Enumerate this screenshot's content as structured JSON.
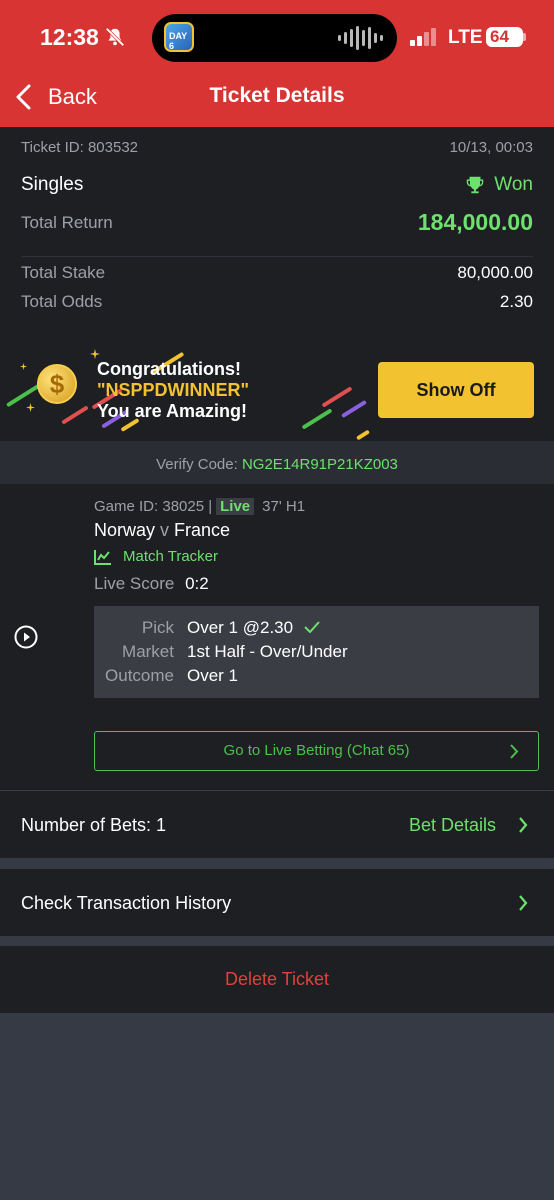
{
  "status_bar": {
    "time": "12:38",
    "network": "LTE",
    "battery": "64",
    "island_app_label": "DAY 6"
  },
  "header": {
    "back_label": "Back",
    "title": "Ticket Details"
  },
  "ticket": {
    "id_label": "Ticket ID: 803532",
    "datetime": "10/13, 00:03",
    "bet_type": "Singles",
    "status": "Won",
    "total_return_label": "Total Return",
    "total_return": "184,000.00",
    "total_stake_label": "Total Stake",
    "total_stake": "80,000.00",
    "total_odds_label": "Total Odds",
    "total_odds": "2.30"
  },
  "promo": {
    "line1": "Congratulations!",
    "code": "\"NSPPDWINNER\"",
    "line3": "You are Amazing!",
    "button": "Show Off"
  },
  "verify": {
    "label": "Verify Code:",
    "code": "NG2E14R91P21KZ003"
  },
  "game": {
    "game_id": "Game ID: 38025 |",
    "live": "Live",
    "time": "37' H1",
    "home": "Norway",
    "vs": "v",
    "away": "France",
    "tracker": "Match Tracker",
    "live_score_label": "Live Score",
    "live_score": "0:2",
    "pick_label": "Pick",
    "pick": "Over 1 @2.30",
    "market_label": "Market",
    "market": "1st Half - Over/Under",
    "outcome_label": "Outcome",
    "outcome": "Over 1",
    "live_betting_button": "Go to Live Betting (Chat 65)"
  },
  "bets": {
    "label": "Number of Bets: 1",
    "details_link": "Bet Details"
  },
  "history": {
    "label": "Check Transaction History"
  },
  "delete": {
    "label": "Delete Ticket"
  },
  "colors": {
    "header_red": "#d83434",
    "win_green": "#6ee06e",
    "accent_yellow": "#f2c230",
    "delete_red": "#e0413c"
  }
}
